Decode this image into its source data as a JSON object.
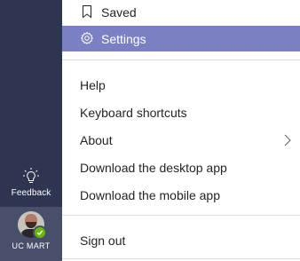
{
  "rail": {
    "feedback": {
      "label": "Feedback",
      "icon": "lightbulb-icon"
    },
    "profile": {
      "label": "UC MART",
      "status": "available",
      "status_color": "#6bb700"
    }
  },
  "menu": {
    "saved": {
      "label": "Saved",
      "icon": "bookmark-icon"
    },
    "settings": {
      "label": "Settings",
      "icon": "gear-icon",
      "selected": true
    },
    "help": {
      "label": "Help"
    },
    "keyboard_shortcuts": {
      "label": "Keyboard shortcuts"
    },
    "about": {
      "label": "About",
      "icon": "chevron-right-icon"
    },
    "download_desktop": {
      "label": "Download the desktop app"
    },
    "download_mobile": {
      "label": "Download the mobile app"
    },
    "sign_out": {
      "label": "Sign out"
    }
  },
  "colors": {
    "rail_background": "#2d3550",
    "selected_item": "#7b7fc3"
  }
}
